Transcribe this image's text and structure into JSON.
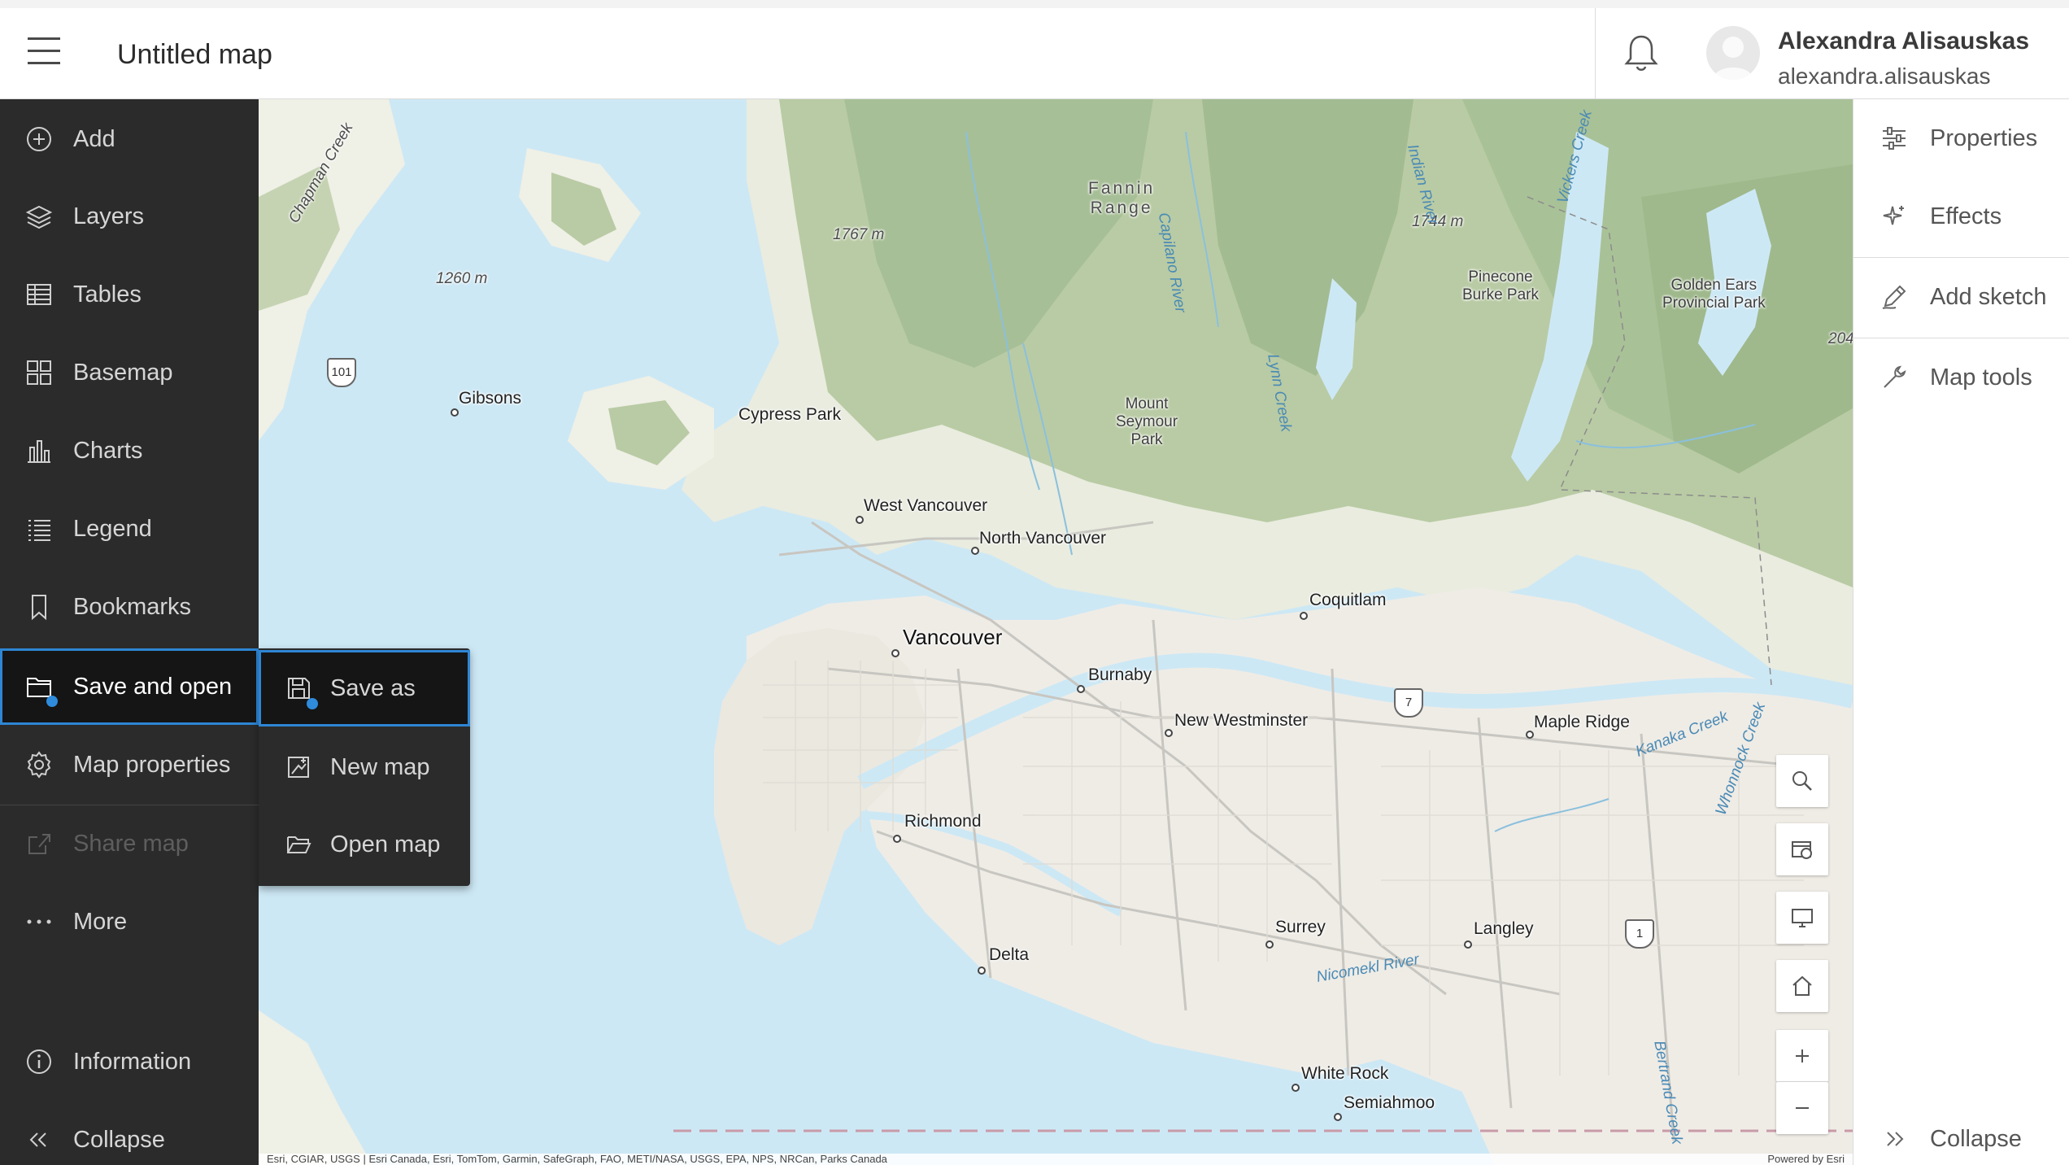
{
  "header": {
    "title": "Untitled map",
    "user_name": "Alexandra Alisauskas",
    "user_handle": "alexandra.alisauskas"
  },
  "left_nav": {
    "items": [
      {
        "label": "Add",
        "icon": "plus-circle-icon"
      },
      {
        "label": "Layers",
        "icon": "layers-icon"
      },
      {
        "label": "Tables",
        "icon": "table-icon"
      },
      {
        "label": "Basemap",
        "icon": "basemap-icon"
      },
      {
        "label": "Charts",
        "icon": "chart-icon"
      },
      {
        "label": "Legend",
        "icon": "legend-icon"
      },
      {
        "label": "Bookmarks",
        "icon": "bookmark-icon"
      },
      {
        "label": "Save and open",
        "icon": "folder-icon",
        "state": "active"
      },
      {
        "label": "Map properties",
        "icon": "gear-icon"
      },
      {
        "label": "Share map",
        "icon": "share-icon",
        "state": "disabled"
      },
      {
        "label": "More",
        "icon": "more-icon"
      }
    ],
    "information": "Information",
    "collapse": "Collapse"
  },
  "flyout": {
    "items": [
      {
        "label": "Save as",
        "icon": "save-icon",
        "state": "active"
      },
      {
        "label": "New map",
        "icon": "new-map-icon"
      },
      {
        "label": "Open map",
        "icon": "open-folder-icon"
      }
    ]
  },
  "right_nav": {
    "items": [
      {
        "label": "Properties",
        "icon": "sliders-icon"
      },
      {
        "label": "Effects",
        "icon": "sparkle-icon"
      },
      {
        "label": "Add sketch",
        "icon": "pencil-icon"
      },
      {
        "label": "Map tools",
        "icon": "wrench-icon"
      }
    ],
    "collapse": "Collapse"
  },
  "map": {
    "labels": {
      "gibsons": "Gibsons",
      "cypress_park": "Cypress Park",
      "west_vancouver": "West Vancouver",
      "north_vancouver": "North Vancouver",
      "vancouver": "Vancouver",
      "burnaby": "Burnaby",
      "new_westminster": "New Westminster",
      "coquitlam": "Coquitlam",
      "maple_ridge": "Maple Ridge",
      "richmond": "Richmond",
      "surrey": "Surrey",
      "langley": "Langley",
      "delta": "Delta",
      "white_rock": "White Rock",
      "semiahmoo": "Semiahmoo",
      "fannin_range_1": "Fannin",
      "fannin_range_2": "Range",
      "mount_seymour_1": "Mount",
      "mount_seymour_2": "Seymour",
      "mount_seymour_3": "Park",
      "pinecone_1": "Pinecone",
      "pinecone_2": "Burke Park",
      "golden_ears_1": "Golden Ears",
      "golden_ears_2": "Provincial Park",
      "peak_1767": "1767 m",
      "peak_1260": "1260 m",
      "peak_1744": "1744 m",
      "peak_204": "204",
      "capilano_river": "Capilano River",
      "indian_river": "Indian River",
      "lynn_creek": "Lynn Creek",
      "kanaka_creek": "Kanaka Creek",
      "whonnock_creek": "Whonnock Creek",
      "nicomekl_river": "Nicomekl River",
      "bertrand_creek": "Bertrand Creek",
      "vickers_creek": "Vickers Creek",
      "chapman_creek": "Chapman Creek",
      "hwy_101": "101",
      "hwy_7": "7",
      "hwy_1": "1"
    },
    "attribution_left": "Esri, CGIAR, USGS | Esri Canada, Esri, TomTom, Garmin, SafeGraph, FAO, METI/NASA, USGS, EPA, NPS, NRCan, Parks Canada",
    "attribution_right": "Powered by Esri"
  },
  "map_widgets": [
    {
      "icon": "search-icon"
    },
    {
      "icon": "layer-list-icon"
    },
    {
      "icon": "fullscreen-icon"
    },
    {
      "icon": "home-icon"
    },
    {
      "icon": "zoom-in-icon",
      "symbol": "+"
    },
    {
      "icon": "zoom-out-icon",
      "symbol": "−"
    }
  ],
  "colors": {
    "accent": "#2e86d4",
    "sidebar_bg": "#2b2b2b",
    "water": "#cde8f5",
    "land": "#f1efe9",
    "forest": "#a7bf96"
  }
}
